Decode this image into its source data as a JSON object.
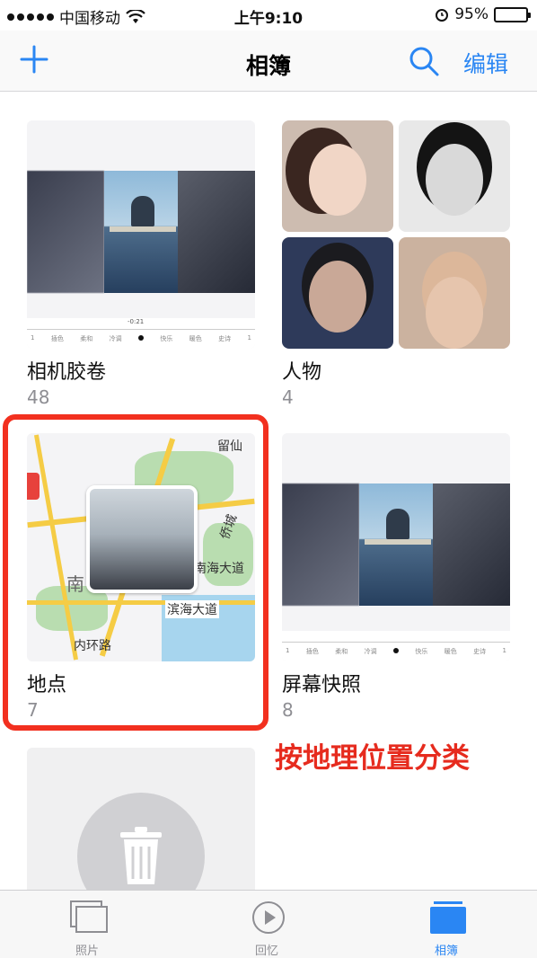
{
  "status_bar": {
    "carrier": "中国移动",
    "time": "上午9:10",
    "battery_percent": "95%",
    "battery_level": 0.95,
    "signal_bars": 5
  },
  "nav": {
    "title": "相簿",
    "edit_label": "编辑",
    "accent_color": "#2a86f3",
    "add_icon": "plus-icon",
    "search_icon": "search-icon"
  },
  "albums": [
    {
      "name": "相机胶卷",
      "count": "48"
    },
    {
      "name": "人物",
      "count": "4"
    },
    {
      "name": "地点",
      "count": "7"
    },
    {
      "name": "屏幕快照",
      "count": "8"
    }
  ],
  "thumb_strip": {
    "time": "-0:21",
    "marks": [
      "1",
      "插色",
      "柔和",
      "冷调",
      "",
      "快乐",
      "暖色",
      "史诗",
      "1"
    ]
  },
  "map_labels": {
    "liuxian": "留仙",
    "qiaocheng": "侨城",
    "nanhai": "南海大道",
    "binhai": "滨海大道",
    "nei": "内环路",
    "nan": "南"
  },
  "annotation": {
    "text": "按地理位置分类",
    "color": "#f2301f"
  },
  "tabs": [
    {
      "label": "照片",
      "icon": "photos-icon",
      "active": false
    },
    {
      "label": "回忆",
      "icon": "memories-icon",
      "active": false
    },
    {
      "label": "相簿",
      "icon": "albums-icon",
      "active": true
    }
  ]
}
